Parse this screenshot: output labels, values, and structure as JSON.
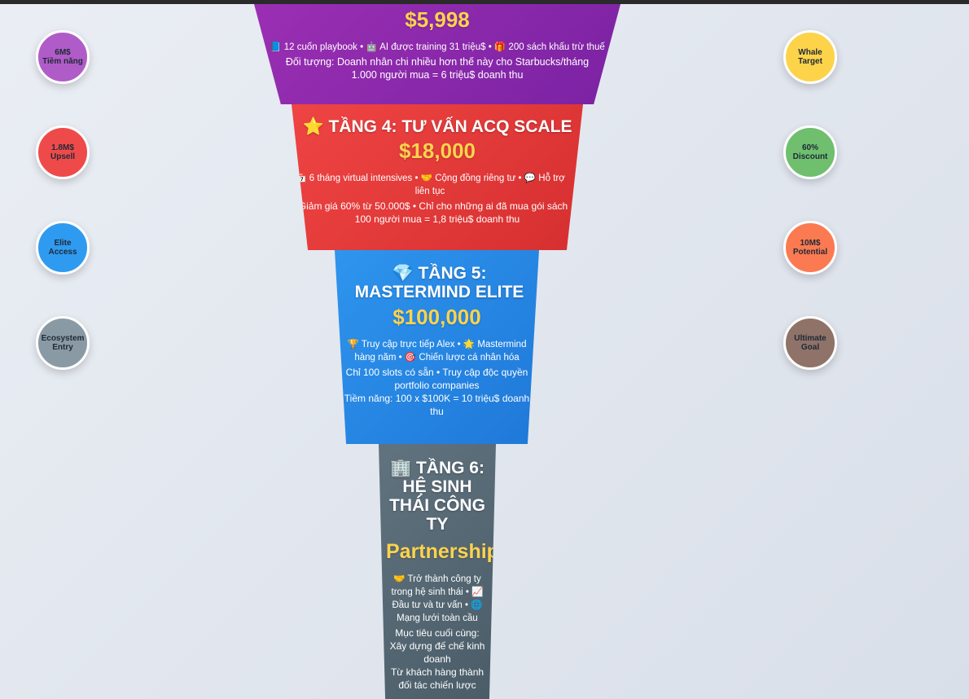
{
  "tiers": [
    {
      "id": "tier3",
      "title": "",
      "price": "$5,998",
      "features": "📘 12 cuốn playbook • 🤖 AI được training 31 triệu$ • 🎁 200 sách khấu trừ thuế",
      "audience": "Đối tượng: Doanh nhân chi nhiều hơn thế này cho Starbucks/tháng",
      "result": "1.000 người mua = 6 triệu$ doanh thu"
    },
    {
      "id": "tier4",
      "title": "⭐ TẦNG 4: TƯ VẤN ACQ SCALE",
      "price": "$18,000",
      "features": "📅 6 tháng virtual intensives • 🤝 Cộng đồng riêng tư • 💬 Hỗ trợ liên tục",
      "audience": "Giảm giá 60% từ 50.000$ • Chỉ cho những ai đã mua gói sách",
      "result": "100 người mua = 1,8 triệu$ doanh thu"
    },
    {
      "id": "tier5",
      "title": "💎 TẦNG 5: MASTERMIND ELITE",
      "price": "$100,000",
      "features": "🏆 Truy cập trực tiếp Alex • 🌟 Mastermind hàng năm • 🎯 Chiến lược cá nhân hóa",
      "audience": "Chỉ 100 slots có sẵn • Truy cập độc quyền portfolio companies",
      "result": "Tiềm năng: 100 x $100K = 10 triệu$ doanh thu"
    },
    {
      "id": "tier6",
      "title": "🏢 TẦNG 6: HỆ SINH THÁI CÔNG TY",
      "price": "Partnership",
      "features": "🤝 Trở thành công ty trong hệ sinh thái • 📈 Đầu tư và tư vấn • 🌐 Mạng lưới toàn cầu",
      "audience": "Mục tiêu cuối cùng: Xây dựng đế chế kinh doanh",
      "result": "Từ khách hàng thành đối tác chiến lược"
    }
  ],
  "left_badges": [
    {
      "line1": "6M$",
      "line2": "Tiềm năng",
      "color": "#b05cc8"
    },
    {
      "line1": "1.8M$",
      "line2": "Upsell",
      "color": "#ef4a4a"
    },
    {
      "line1": "Elite",
      "line2": "Access",
      "color": "#2f9bf0"
    },
    {
      "line1": "Ecosystem",
      "line2": "Entry",
      "color": "#8a9aa5"
    }
  ],
  "right_badges": [
    {
      "line1": "Whale",
      "line2": "Target",
      "color": "#fdd34a"
    },
    {
      "line1": "60%",
      "line2": "Discount",
      "color": "#6fbf6e"
    },
    {
      "line1": "10M$",
      "line2": "Potential",
      "color": "#fb7a52"
    },
    {
      "line1": "Ultimate",
      "line2": "Goal",
      "color": "#8f7268"
    }
  ]
}
